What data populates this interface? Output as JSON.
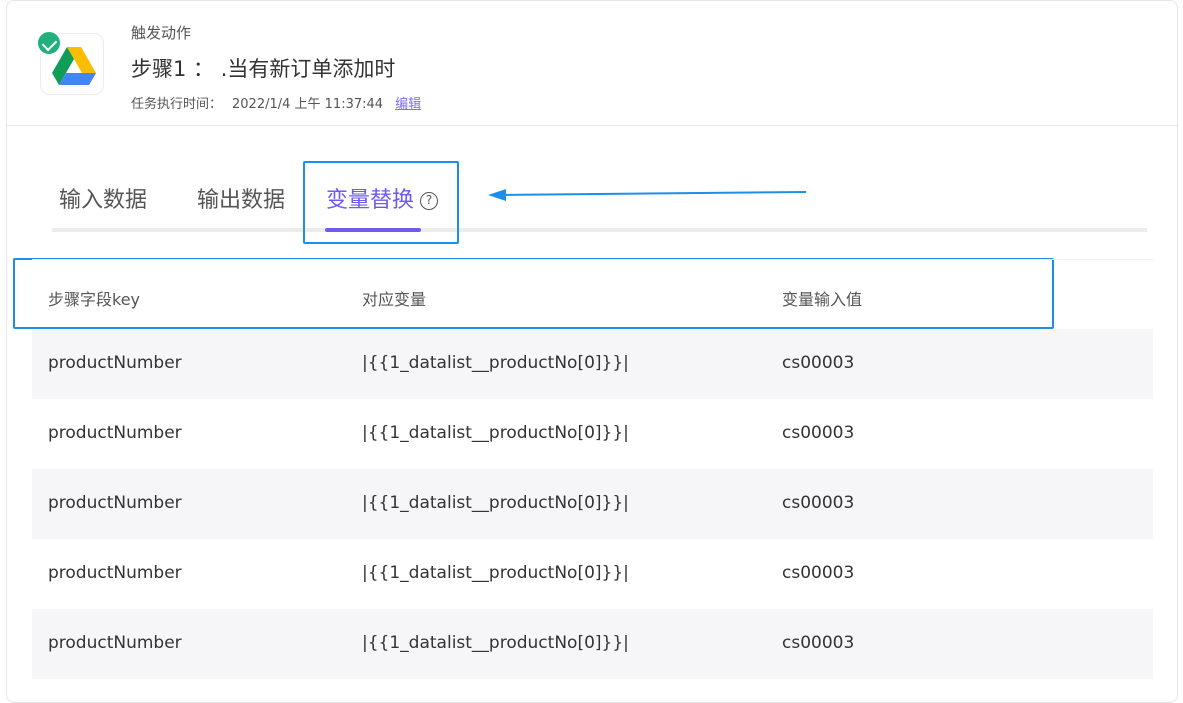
{
  "header": {
    "trigger_label": "触发动作",
    "step_title": "步骤1 ： .当有新订单添加时",
    "time_label": "任务执行时间：",
    "time_value": "2022/1/4 上午 11:37:44",
    "edit_label": "编辑"
  },
  "tabs": [
    {
      "label": "输入数据",
      "active": false
    },
    {
      "label": "输出数据",
      "active": false
    },
    {
      "label": "变量替换",
      "active": true
    }
  ],
  "help_icon_glyph": "?",
  "table": {
    "columns": [
      "步骤字段key",
      "对应变量",
      "变量输入值"
    ],
    "rows": [
      [
        "productNumber",
        "|{{1_datalist__productNo[0]}}|",
        "cs00003"
      ],
      [
        "productNumber",
        "|{{1_datalist__productNo[0]}}|",
        "cs00003"
      ],
      [
        "productNumber",
        "|{{1_datalist__productNo[0]}}|",
        "cs00003"
      ],
      [
        "productNumber",
        "|{{1_datalist__productNo[0]}}|",
        "cs00003"
      ],
      [
        "productNumber",
        "|{{1_datalist__productNo[0]}}|",
        "cs00003"
      ]
    ]
  },
  "colors": {
    "accent": "#6d5bf0",
    "annotation": "#1e8fe8",
    "success": "#22b07d"
  }
}
